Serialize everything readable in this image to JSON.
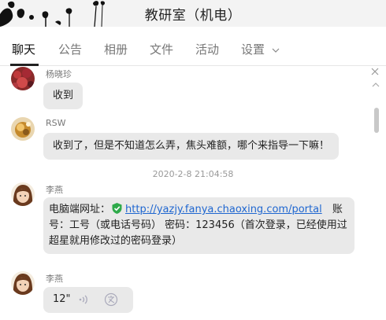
{
  "window": {
    "title": "教研室（机电）"
  },
  "tabs": [
    {
      "label": "聊天"
    },
    {
      "label": "公告"
    },
    {
      "label": "相册"
    },
    {
      "label": "文件"
    },
    {
      "label": "活动"
    },
    {
      "label": "设置"
    }
  ],
  "messages": [
    {
      "sender": "杨晓珍",
      "text": "收到"
    },
    {
      "sender": "RSW",
      "text": "收到了，但是不知道怎么弄，焦头难额，哪个来指导一下嘛！"
    },
    {
      "timestamp": "2020-2-8 21:04:58",
      "sender": "李燕",
      "prefix": "电脑端网址：",
      "link": "http://yazjy.fanya.chaoxing.com/portal",
      "suffix_1": "账",
      "line2": "号：工号（或电话号码） 密码：123456（首次登录，已经使用过",
      "line3": "超星就用修改过的密码登录）"
    },
    {
      "sender": "李燕",
      "voice_length": "12\""
    }
  ],
  "icons": {
    "shield": "verified-shield-icon",
    "voice": "voice-wave-icon",
    "translate": "voice-to-text-icon",
    "close": "close-icon",
    "chevron": "chevron-down-icon"
  },
  "colors": {
    "link": "#1e66d0",
    "shield": "#2eaa4a",
    "bubble": "#e9e9e9"
  }
}
